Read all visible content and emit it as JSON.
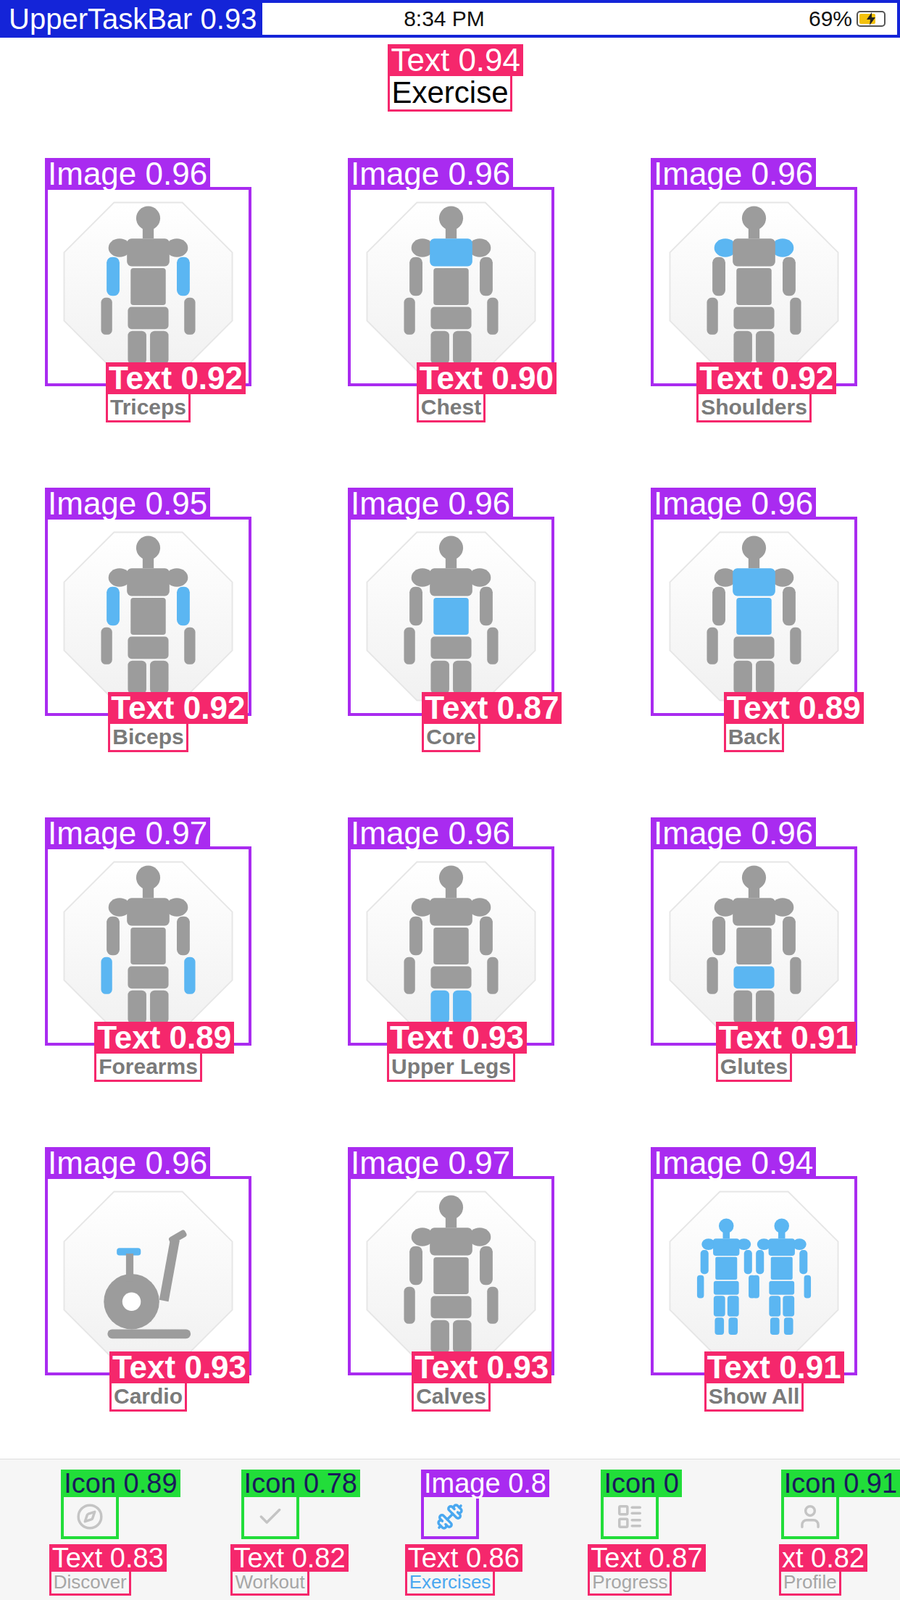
{
  "status_bar": {
    "label": "UpperTaskBar 0.93",
    "time": "8:34 PM",
    "battery": "69%",
    "battery_level": 0.69,
    "charging": true
  },
  "header": {
    "title": "Exercise",
    "label": "Text 0.94"
  },
  "tiles": [
    {
      "name": "Triceps",
      "image_label": "Image 0.96",
      "text_label": "Text 0.92"
    },
    {
      "name": "Chest",
      "image_label": "Image 0.96",
      "text_label": "Text 0.90"
    },
    {
      "name": "Shoulders",
      "image_label": "Image 0.96",
      "text_label": "Text 0.92"
    },
    {
      "name": "Biceps",
      "image_label": "Image 0.95",
      "text_label": "Text 0.92"
    },
    {
      "name": "Core",
      "image_label": "Image 0.96",
      "text_label": "Text 0.87"
    },
    {
      "name": "Back",
      "image_label": "Image 0.96",
      "text_label": "Text 0.89"
    },
    {
      "name": "Forearms",
      "image_label": "Image 0.97",
      "text_label": "Text 0.89"
    },
    {
      "name": "Upper Legs",
      "image_label": "Image 0.96",
      "text_label": "Text 0.93"
    },
    {
      "name": "Glutes",
      "image_label": "Image 0.96",
      "text_label": "Text 0.91"
    },
    {
      "name": "Cardio",
      "image_label": "Image 0.96",
      "text_label": "Text 0.93"
    },
    {
      "name": "Calves",
      "image_label": "Image 0.97",
      "text_label": "Text 0.93"
    },
    {
      "name": "Show All",
      "image_label": "Image 0.94",
      "text_label": "Text 0.91"
    }
  ],
  "tab_bar": {
    "items": [
      {
        "label": "Discover",
        "selected": false,
        "kind": "icon",
        "icon_label": "Icon 0.89",
        "text_label": "Text 0.83"
      },
      {
        "label": "Workout",
        "selected": false,
        "kind": "icon",
        "icon_label": "Icon 0.78",
        "text_label": "Text 0.82"
      },
      {
        "label": "Exercises",
        "selected": true,
        "kind": "image",
        "icon_label": "Image 0.8",
        "text_label": "Text 0.86"
      },
      {
        "label": "Progress",
        "selected": false,
        "kind": "icon",
        "icon_label": "Icon 0",
        "text_label": "Text 0.87"
      },
      {
        "label": "Profile",
        "selected": false,
        "kind": "icon",
        "icon_label": "Icon 0.91",
        "text_label": "xt 0.82"
      }
    ]
  }
}
